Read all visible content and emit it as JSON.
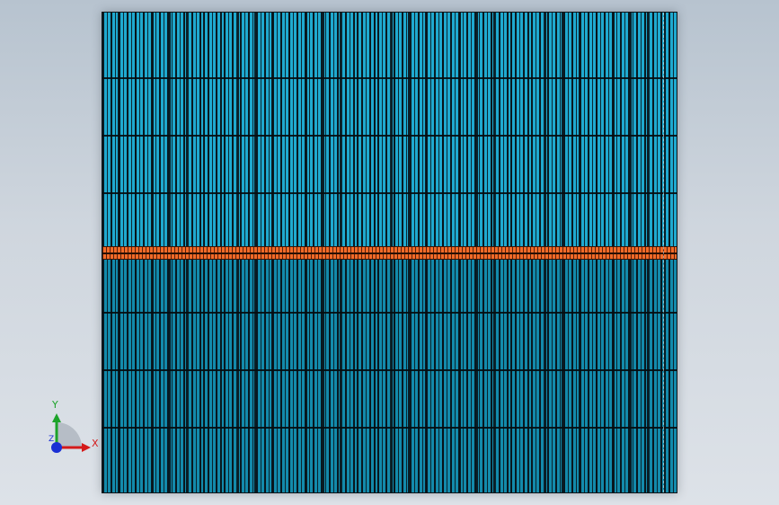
{
  "triad": {
    "x_label": "X",
    "y_label": "Y",
    "z_label": "Z",
    "x_color": "#d41a1a",
    "y_color": "#1ca32a",
    "z_color": "#1a2fd4"
  },
  "model": {
    "top_color": "#1fa9cf",
    "bottom_color": "#138aab",
    "strip_color": "#f26a28"
  }
}
